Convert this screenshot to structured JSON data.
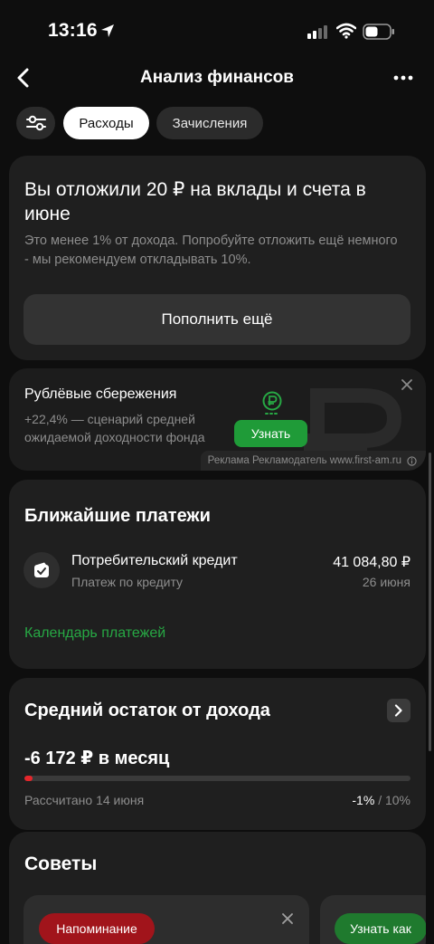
{
  "status_bar": {
    "time": "13:16"
  },
  "header": {
    "title": "Анализ финансов"
  },
  "tabs": [
    {
      "label": "Расходы",
      "active": true
    },
    {
      "label": "Зачисления",
      "active": false
    }
  ],
  "savings": {
    "title": "Вы отложили 20 ₽ на вклады и счета в июне",
    "description": "Это менее 1% от дохода. Попробуйте отложить ещё немного - мы рекомендуем откладывать 10%.",
    "button_label": "Пополнить ещё"
  },
  "ad": {
    "title": "Рублёвые сбережения",
    "description": "+22,4% — сценарий средней ожидаемой доходности фонда",
    "button_label": "Узнать",
    "disclaimer": "Реклама Рекламодатель www.first-am.ru"
  },
  "payments": {
    "title": "Ближайшие платежи",
    "items": [
      {
        "name": "Потребительский кредит",
        "subtitle": "Платеж по кредиту",
        "amount": "41 084,80 ₽",
        "date": "26 июня"
      }
    ],
    "calendar_link": "Календарь платежей"
  },
  "balance": {
    "title": "Средний остаток от дохода",
    "value": "-6 172 ₽ в месяц",
    "calculated": "Рассчитано 14 июня",
    "current_percent": "-1%",
    "separator": "/",
    "target_percent": "10%",
    "progress_fraction": 0.02
  },
  "tips": {
    "title": "Советы",
    "cards": [
      {
        "badge": "Напоминание"
      },
      {
        "badge": "Узнать как"
      }
    ]
  },
  "colors": {
    "accent_green": "#1f9b38",
    "link_green": "#27a844",
    "alert_red": "#e5262b",
    "card_bg": "#1f1f1f",
    "page_bg": "#0e0e0e"
  },
  "icons": {
    "back": "chevron-left-icon",
    "more": "more-horizontal-icon",
    "filter": "sliders-icon",
    "ad_close": "close-icon",
    "ad_coin": "ruble-coin-icon",
    "payment": "wallet-check-icon",
    "balance_arrow": "chevron-right-icon",
    "tip_close": "close-icon"
  }
}
